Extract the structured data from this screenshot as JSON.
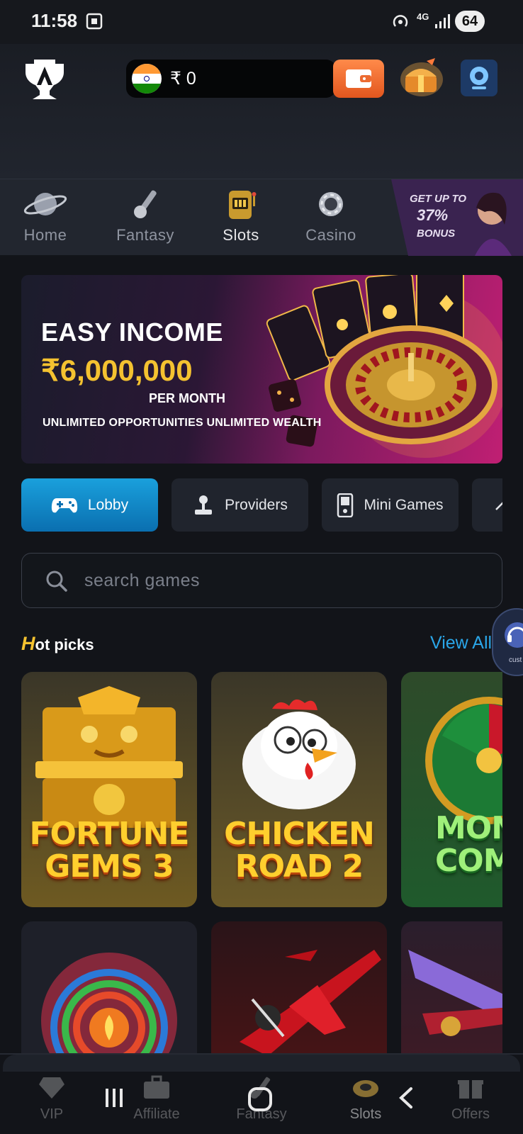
{
  "status_bar": {
    "time": "11:58",
    "network": "4G",
    "battery": "64"
  },
  "header": {
    "balance": "₹ 0",
    "flag": "india-flag"
  },
  "categories": [
    {
      "label": "Home",
      "icon": "planet-icon"
    },
    {
      "label": "Fantasy",
      "icon": "cricket-icon"
    },
    {
      "label": "Slots",
      "icon": "slot-machine-icon",
      "active": true
    },
    {
      "label": "Casino",
      "icon": "chip-icon"
    }
  ],
  "promo": {
    "line1": "GET UP TO",
    "line2": "37%",
    "line3": "BONUS"
  },
  "banner": {
    "title": "EASY INCOME",
    "amount": "₹6,000,000",
    "per": "PER MONTH",
    "subtitle": "UNLIMITED OPPORTUNITIES UNLIMITED WEALTH"
  },
  "tabs": [
    {
      "label": "Lobby",
      "active": true
    },
    {
      "label": "Providers"
    },
    {
      "label": "Mini Games"
    }
  ],
  "search": {
    "placeholder": "search games"
  },
  "hot_picks": {
    "title_first": "H",
    "title_rest": "ot picks",
    "view_all": "View All",
    "games": [
      {
        "line1": "FORTUNE",
        "line2": "GEMS 3"
      },
      {
        "line1": "CHICKEN",
        "line2": "ROAD 2"
      },
      {
        "line1": "MON",
        "line2": "COM"
      }
    ]
  },
  "support": {
    "label": "cust ser"
  },
  "bottom_nav": [
    {
      "label": "VIP"
    },
    {
      "label": "Affiliate"
    },
    {
      "label": "Fantasy"
    },
    {
      "label": "Slots",
      "active": true
    },
    {
      "label": "Offers"
    }
  ],
  "colors": {
    "accent": "#1aa0dc",
    "gold": "#f4c230",
    "background": "#121419"
  }
}
